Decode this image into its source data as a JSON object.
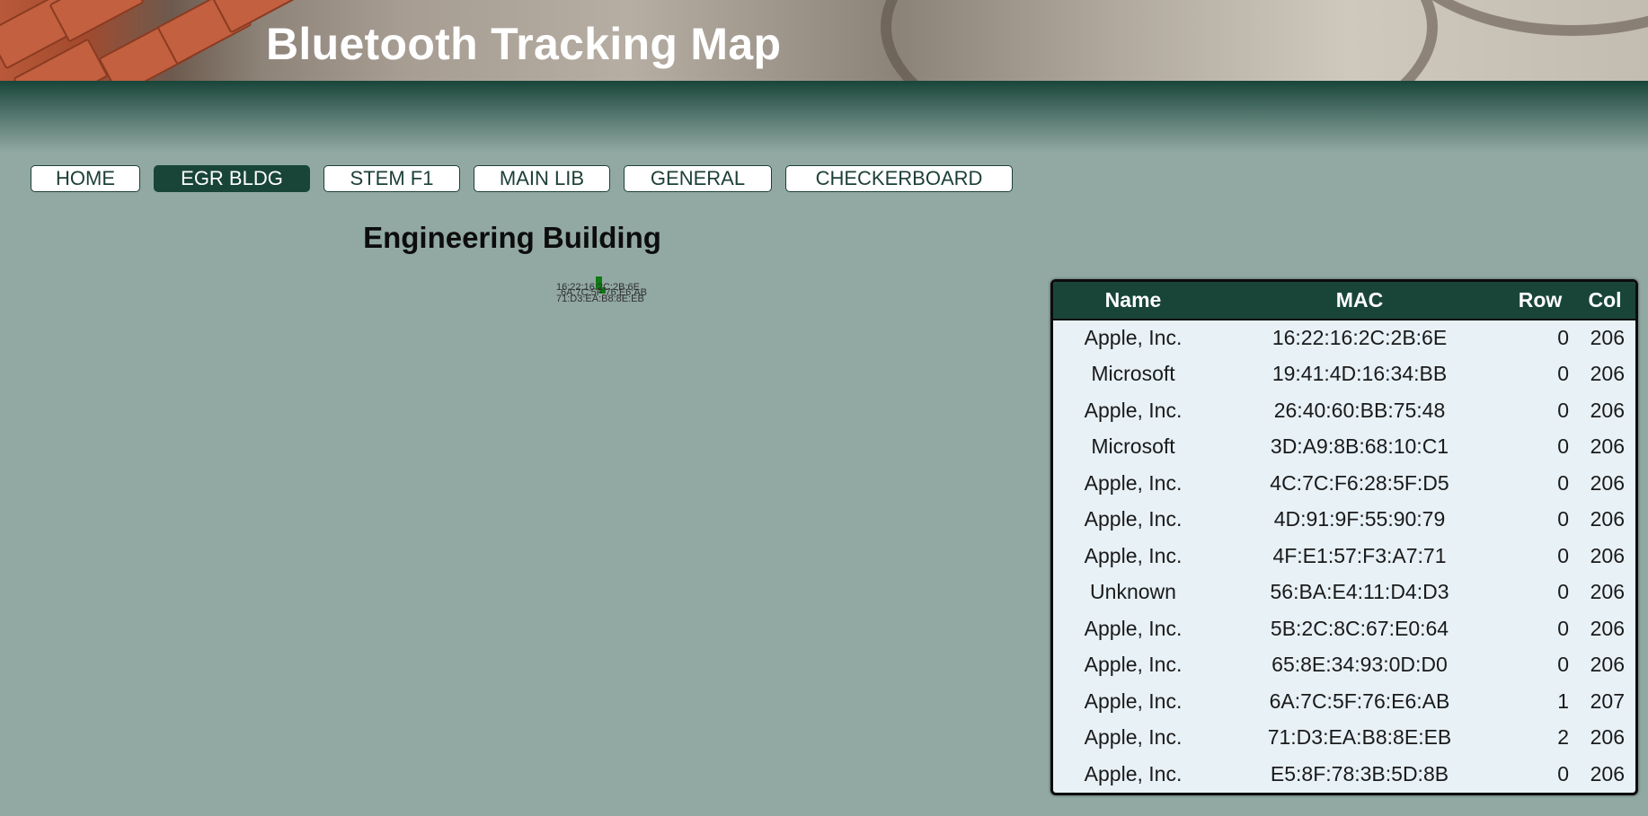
{
  "header": {
    "title": "Bluetooth Tracking Map"
  },
  "nav": {
    "items": [
      {
        "label": "HOME",
        "active": false
      },
      {
        "label": "EGR BLDG",
        "active": true
      },
      {
        "label": "STEM F1",
        "active": false
      },
      {
        "label": "MAIN LIB",
        "active": false
      },
      {
        "label": "GENERAL",
        "active": false
      },
      {
        "label": "CHECKERBOARD",
        "active": false
      }
    ]
  },
  "map": {
    "title": "Engineering Building",
    "labels": [
      "16:22:16:2C:2B:6E",
      "6A:7C:5F:76:E6:AB",
      "71:D3:EA:B8:8E:EB"
    ]
  },
  "table": {
    "headers": {
      "name": "Name",
      "mac": "MAC",
      "row": "Row",
      "col": "Col"
    },
    "rows": [
      {
        "name": "Apple, Inc.",
        "mac": "16:22:16:2C:2B:6E",
        "row": "0",
        "col": "206"
      },
      {
        "name": "Microsoft",
        "mac": "19:41:4D:16:34:BB",
        "row": "0",
        "col": "206"
      },
      {
        "name": "Apple, Inc.",
        "mac": "26:40:60:BB:75:48",
        "row": "0",
        "col": "206"
      },
      {
        "name": "Microsoft",
        "mac": "3D:A9:8B:68:10:C1",
        "row": "0",
        "col": "206"
      },
      {
        "name": "Apple, Inc.",
        "mac": "4C:7C:F6:28:5F:D5",
        "row": "0",
        "col": "206"
      },
      {
        "name": "Apple, Inc.",
        "mac": "4D:91:9F:55:90:79",
        "row": "0",
        "col": "206"
      },
      {
        "name": "Apple, Inc.",
        "mac": "4F:E1:57:F3:A7:71",
        "row": "0",
        "col": "206"
      },
      {
        "name": "Unknown",
        "mac": "56:BA:E4:11:D4:D3",
        "row": "0",
        "col": "206"
      },
      {
        "name": "Apple, Inc.",
        "mac": "5B:2C:8C:67:E0:64",
        "row": "0",
        "col": "206"
      },
      {
        "name": "Apple, Inc.",
        "mac": "65:8E:34:93:0D:D0",
        "row": "0",
        "col": "206"
      },
      {
        "name": "Apple, Inc.",
        "mac": "6A:7C:5F:76:E6:AB",
        "row": "1",
        "col": "207"
      },
      {
        "name": "Apple, Inc.",
        "mac": "71:D3:EA:B8:8E:EB",
        "row": "2",
        "col": "206"
      },
      {
        "name": "Apple, Inc.",
        "mac": "E5:8F:78:3B:5D:8B",
        "row": "0",
        "col": "206"
      }
    ]
  },
  "colors": {
    "accent": "#194539",
    "background": "#92a9a3",
    "table_bg": "#e7f1f6",
    "marker": "#0e7b14"
  }
}
